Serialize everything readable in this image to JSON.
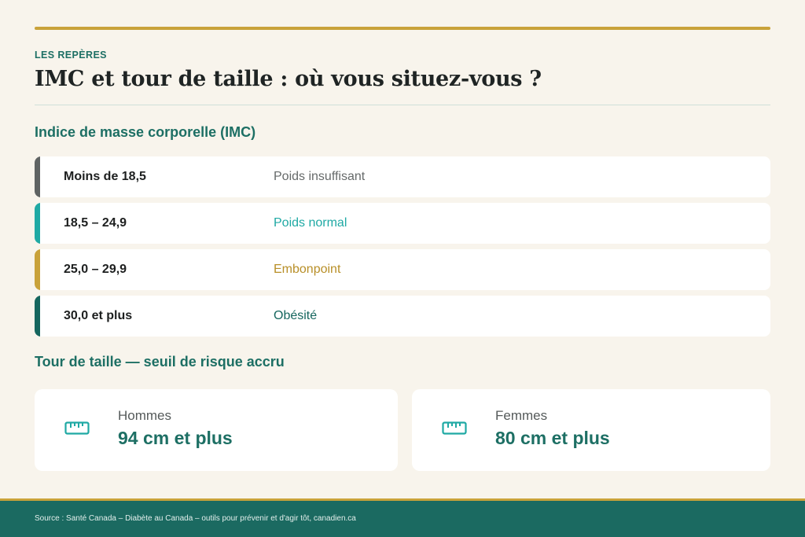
{
  "header": {
    "eyebrow": "LES REPÈRES",
    "title": "IMC et tour de taille : où vous situez-vous ?"
  },
  "bmi": {
    "heading": "Indice de masse corporelle (IMC)",
    "rows": [
      {
        "range": "Moins de 18,5",
        "category": "Poids insuffisant",
        "accent_color": "#5f6363",
        "text_color": "#666a6a"
      },
      {
        "range": "18,5 – 24,9",
        "category": "Poids normal",
        "accent_color": "#1fa9a4",
        "text_color": "#1fa9a4"
      },
      {
        "range": "25,0 – 29,9",
        "category": "Embonpoint",
        "accent_color": "#c9a23a",
        "text_color": "#b88f28"
      },
      {
        "range": "30,0 et plus",
        "category": "Obésité",
        "accent_color": "#15665e",
        "text_color": "#15665e"
      }
    ]
  },
  "waist": {
    "heading": "Tour de taille — seuil de risque accru",
    "cards": [
      {
        "group": "Hommes",
        "threshold": "94 cm et plus",
        "icon": "ruler-icon"
      },
      {
        "group": "Femmes",
        "threshold": "80 cm et plus",
        "icon": "ruler-icon"
      }
    ]
  },
  "footer": {
    "source": "Source :  Santé Canada – Diabète au Canada – outils pour prévenir et d'agir tôt, canadien.ca"
  },
  "colors": {
    "background": "#f8f4ec",
    "primary_teal": "#1d6f64",
    "gold": "#c9a23a",
    "footer_bg": "#1b6a61"
  }
}
